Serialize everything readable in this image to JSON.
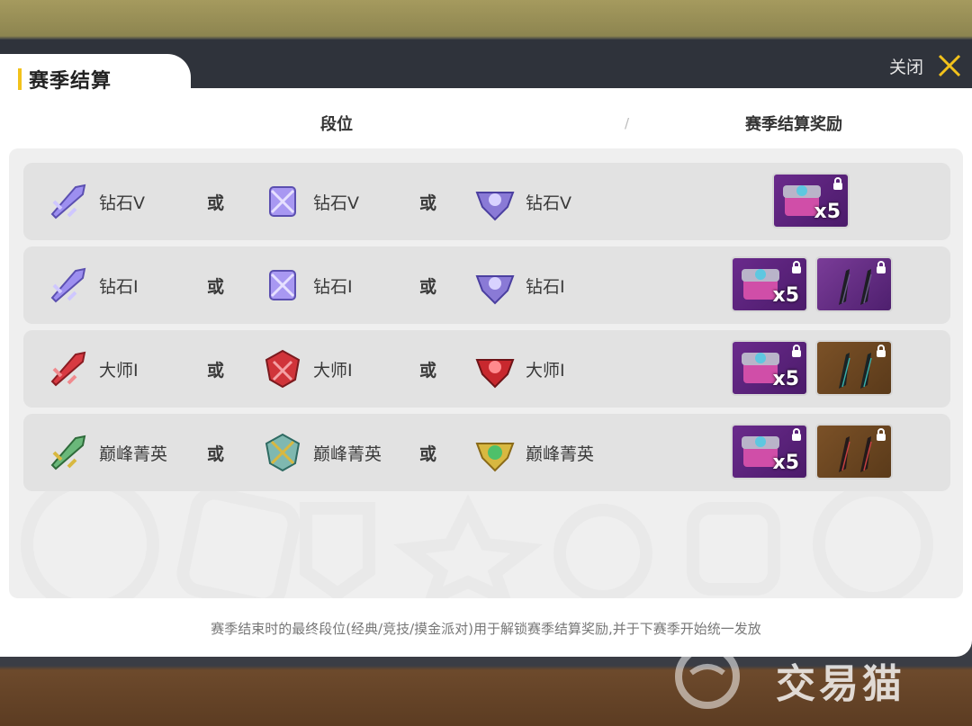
{
  "header": {
    "title": "赛季结算",
    "close_label": "关闭"
  },
  "columns": {
    "rank": "段位",
    "separator": "/",
    "reward": "赛季结算奖励"
  },
  "or_label": "或",
  "rows": [
    {
      "ranks": [
        "钻石V",
        "钻石V",
        "钻石V"
      ],
      "emblem_color": "#8a7ad6",
      "rewards": [
        {
          "type": "chest",
          "count": "x5",
          "bg": "purple"
        }
      ]
    },
    {
      "ranks": [
        "钻石I",
        "钻石I",
        "钻石I"
      ],
      "emblem_color": "#8a7ad6",
      "rewards": [
        {
          "type": "chest",
          "count": "x5",
          "bg": "purple"
        },
        {
          "type": "blades",
          "bg": "dark"
        }
      ]
    },
    {
      "ranks": [
        "大师I",
        "大师I",
        "大师I"
      ],
      "emblem_color": "#d0343a",
      "rewards": [
        {
          "type": "chest",
          "count": "x5",
          "bg": "purple"
        },
        {
          "type": "blades",
          "bg": "orange"
        }
      ]
    },
    {
      "ranks": [
        "巅峰菁英",
        "巅峰菁英",
        "巅峰菁英"
      ],
      "emblem_color": "#5aa86a",
      "rewards": [
        {
          "type": "chest",
          "count": "x5",
          "bg": "purple"
        },
        {
          "type": "blades",
          "bg": "orange"
        }
      ]
    }
  ],
  "footer": "赛季结束时的最终段位(经典/竞技/摸金派对)用于解锁赛季结算奖励,并于下赛季开始统一发放",
  "watermark": "交易猫",
  "colors": {
    "accent": "#f2c21b",
    "panel": "#ffffff",
    "row_bg": "#e2e2e2"
  }
}
